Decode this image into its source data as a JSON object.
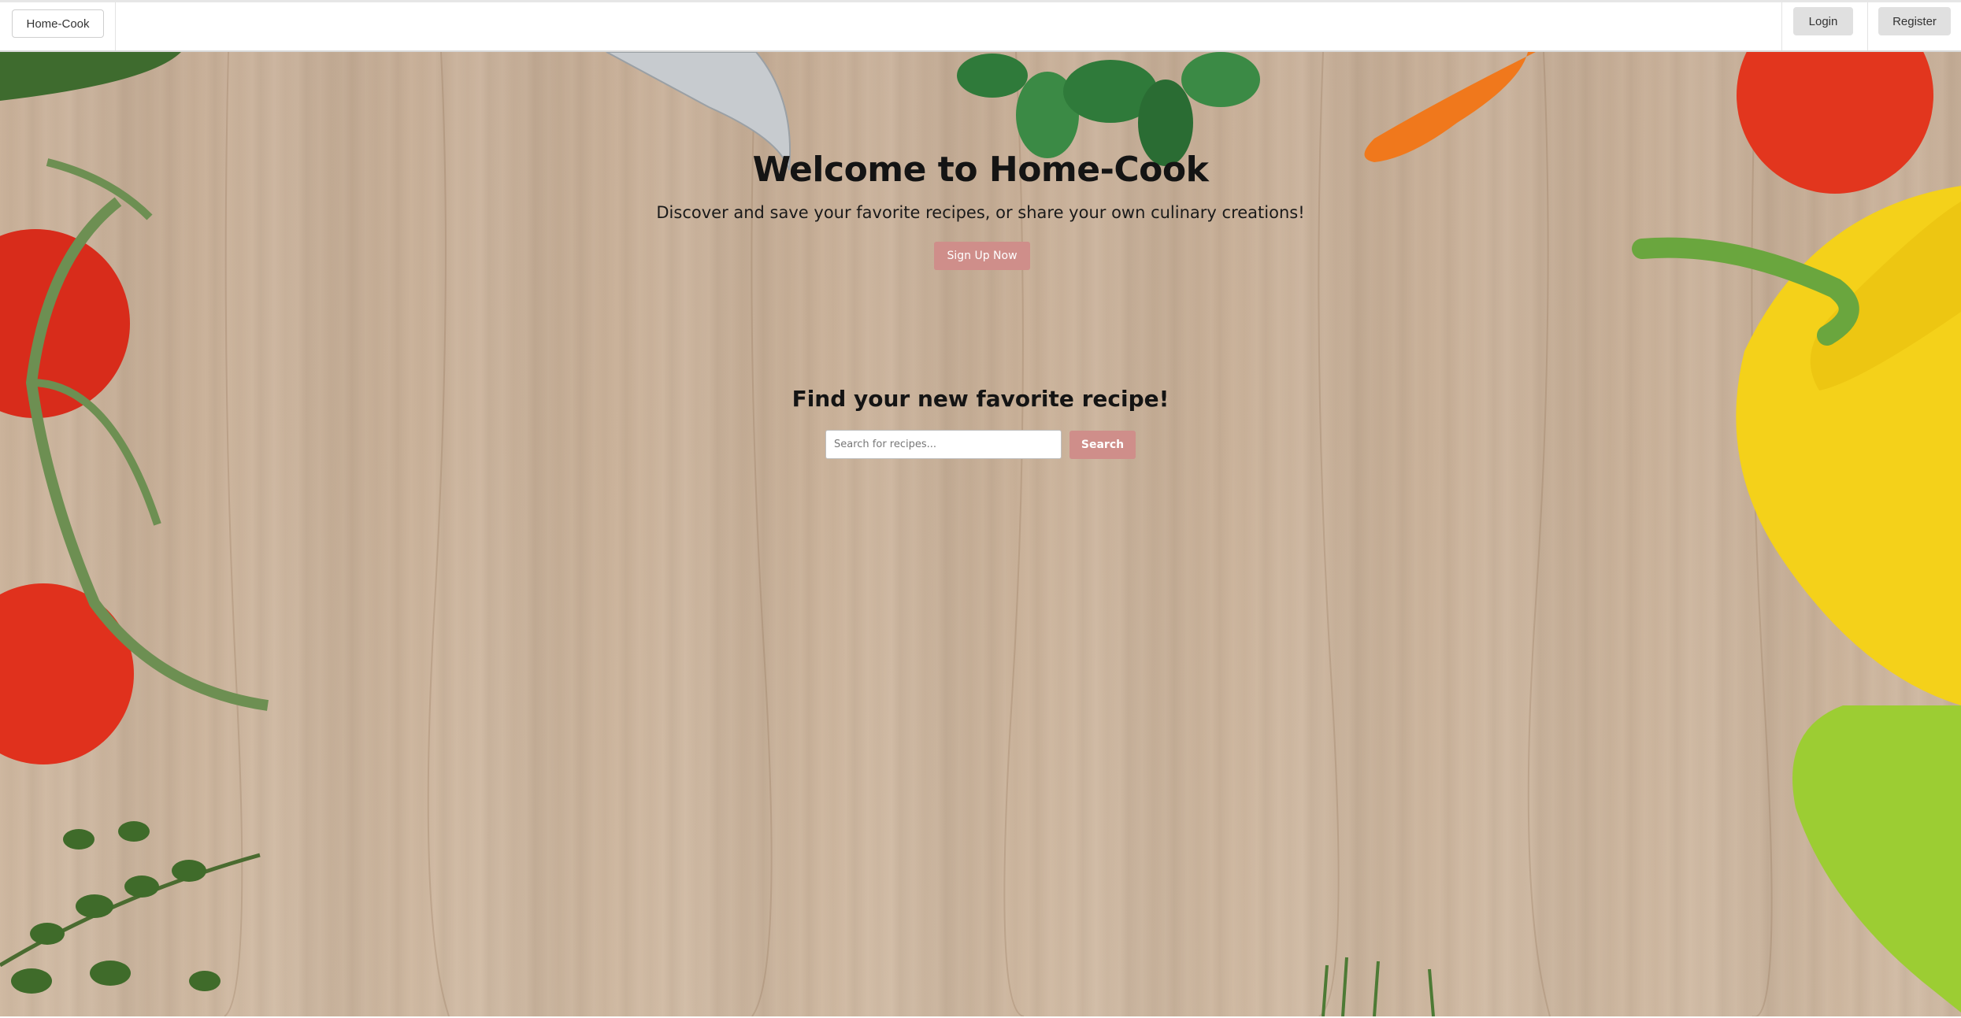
{
  "navbar": {
    "brand_label": "Home-Cook",
    "login_label": "Login",
    "register_label": "Register"
  },
  "hero": {
    "title": "Welcome to Home-Cook",
    "subtitle": "Discover and save your favorite recipes, or share your own culinary creations!",
    "signup_label": "Sign Up Now"
  },
  "search": {
    "heading": "Find your new favorite recipe!",
    "placeholder": "Search for recipes...",
    "value": "",
    "button_label": "Search"
  },
  "colors": {
    "accent": "#cf8e8a",
    "nav_button_bg": "#e0e0e0",
    "wood_background": "#cbb39b"
  },
  "icons": {
    "background_decor": [
      "knife-blade",
      "parsley-leaves",
      "carrot",
      "tomato",
      "yellow-bell-pepper",
      "green-pepper",
      "thyme-sprig",
      "rosemary-sprig"
    ]
  }
}
